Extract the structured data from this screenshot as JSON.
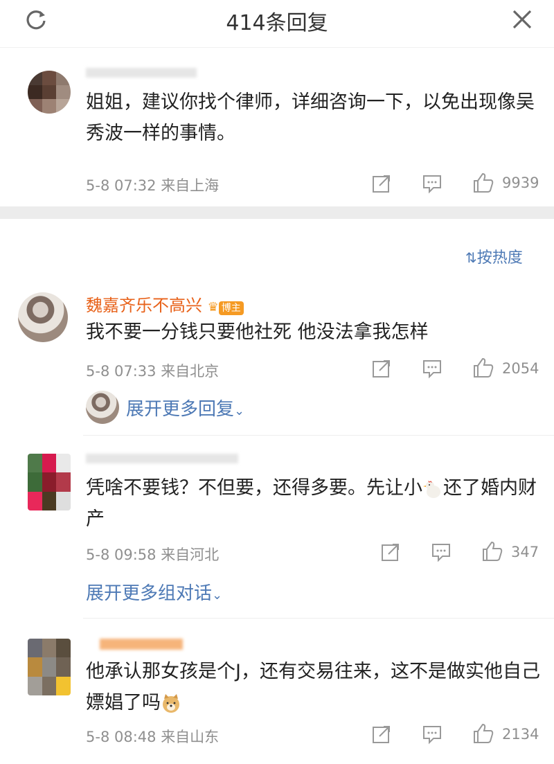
{
  "header": {
    "title": "414条回复"
  },
  "sort": {
    "label": "按热度"
  },
  "comments": [
    {
      "name": "",
      "text": "姐姐，建议你找个律师，详细咨询一下，以免出现像吴秀波一样的事情。",
      "time": "5-8 07:32",
      "location": "来自上海",
      "likes": "9939"
    },
    {
      "name": "魏嘉齐乐不高兴",
      "badge": "博主",
      "text": "我不要一分钱只要他社死 他没法拿我怎样",
      "time": "5-8 07:33",
      "location": "来自北京",
      "likes": "2054",
      "expand": "展开更多回复"
    },
    {
      "name": "",
      "text_before": "凭啥不要钱？不但要，还得多要。先让小",
      "text_after": "还了婚内财产",
      "time": "5-8 09:58",
      "location": "来自河北",
      "likes": "347",
      "expand": "展开更多组对话"
    },
    {
      "name": "",
      "text": "他承认那女孩是个J，还有交易往来，这不是做实他自己嫖娼了吗",
      "time": "5-8 08:48",
      "location": "来自山东",
      "likes": "2134"
    }
  ],
  "icons": {
    "refresh": "refresh-icon",
    "close": "close-icon",
    "share": "share-icon",
    "comment": "comment-icon",
    "like": "thumbs-up-icon",
    "chicken": "chicken-emoji-icon",
    "doge": "doge-emoji-icon"
  },
  "colors": {
    "link": "#4d79b5",
    "name_highlight": "#e8621a",
    "meta": "#8f8f8f"
  }
}
